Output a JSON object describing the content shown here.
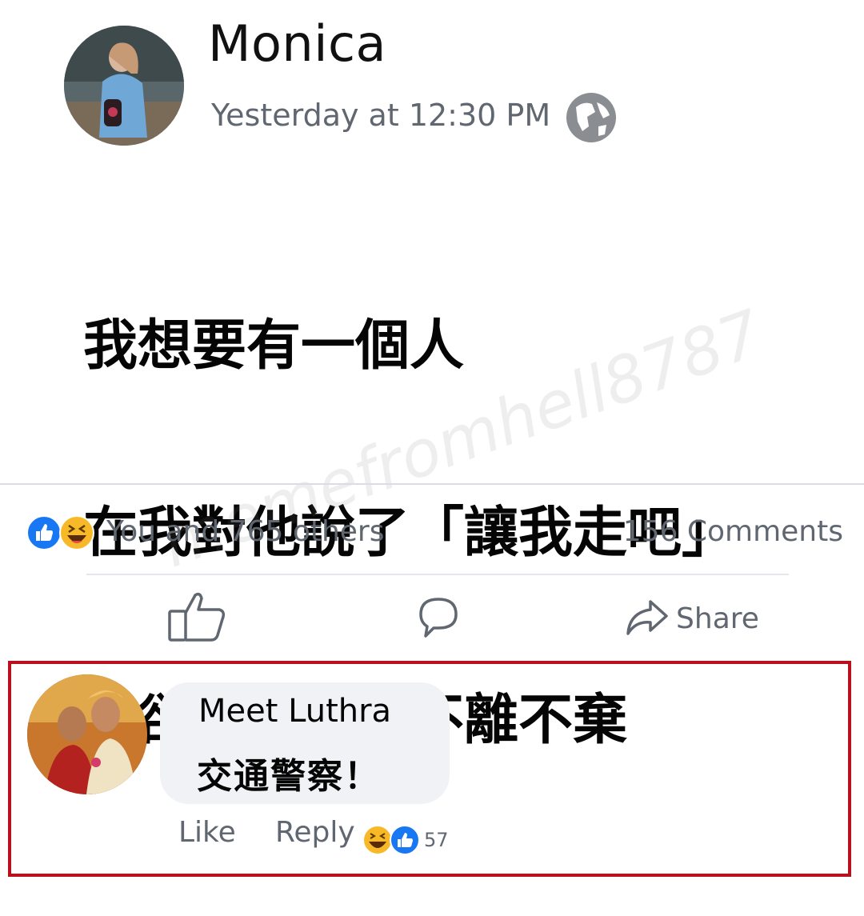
{
  "post": {
    "author_name": "Monica",
    "timestamp": "Yesterday at 12:30 PM",
    "privacy_icon": "globe-icon",
    "text_lines": [
      "我想要有一個人",
      "在我對他說了「讓我走吧」",
      "他卻依然對我不離不棄"
    ]
  },
  "stats": {
    "reaction_icons": [
      "like-reaction-icon",
      "haha-reaction-icon"
    ],
    "reaction_summary": "You and 765 others",
    "comments_count": "156  Comments"
  },
  "actions": {
    "share_label": "Share"
  },
  "comment": {
    "author_name": "Meet Luthra",
    "text": "交通警察！",
    "like_label": "Like",
    "reply_label": "Reply",
    "reaction_count": "57"
  },
  "watermark": "memefromhell8787",
  "colors": {
    "like_blue": "#1877f2",
    "haha_yellow": "#f7b928",
    "highlight_red": "#b8101c",
    "secondary_text": "#606770"
  }
}
